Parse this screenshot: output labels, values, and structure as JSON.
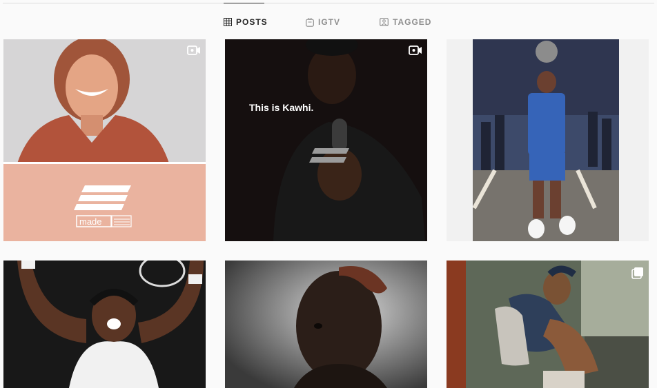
{
  "tabs": [
    {
      "label": "POSTS",
      "icon": "grid-icon",
      "active": true
    },
    {
      "label": "IGTV",
      "icon": "igtv-icon",
      "active": false
    },
    {
      "label": "TAGGED",
      "icon": "tagged-icon",
      "active": false
    }
  ],
  "posts": [
    {
      "badge": "video-icon",
      "brand": {
        "made": "made"
      }
    },
    {
      "badge": "video-icon",
      "caption": "This is Kawhi."
    },
    {
      "badge": null
    },
    {
      "badge": null
    },
    {
      "badge": null
    },
    {
      "badge": "carousel-icon"
    }
  ]
}
